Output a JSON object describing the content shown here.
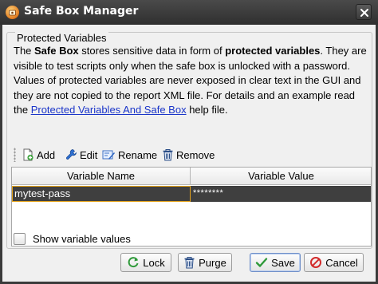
{
  "window": {
    "title": "Safe Box Manager",
    "icons": {
      "app": "safe-box-icon",
      "close": "close-icon"
    }
  },
  "group": {
    "legend": "Protected Variables"
  },
  "description": {
    "t1": "The ",
    "b1": "Safe Box",
    "t2": " stores sensitive data in form of ",
    "b2": "protected variables",
    "t3": ". They are visible to test scripts only when the safe box is unlocked with a password. Values of protected variables are never exposed in clear text in the GUI and they are not copied to the report XML file. For details and an example read the ",
    "link": "Protected Variables And Safe Box",
    "t4": " help file."
  },
  "toolbar": {
    "add": "Add",
    "edit": "Edit",
    "rename": "Rename",
    "remove": "Remove"
  },
  "table": {
    "columns": [
      "Variable Name",
      "Variable Value"
    ],
    "rows": [
      {
        "name": "mytest-pass",
        "value": "********"
      }
    ]
  },
  "show_values": {
    "label": "Show variable values",
    "checked": false
  },
  "buttons": {
    "lock": "Lock",
    "purge": "Purge",
    "save": "Save",
    "cancel": "Cancel"
  },
  "colors": {
    "selection_row": "#3f3f3f",
    "selection_border": "#e3a21a",
    "link": "#1a35c9"
  }
}
